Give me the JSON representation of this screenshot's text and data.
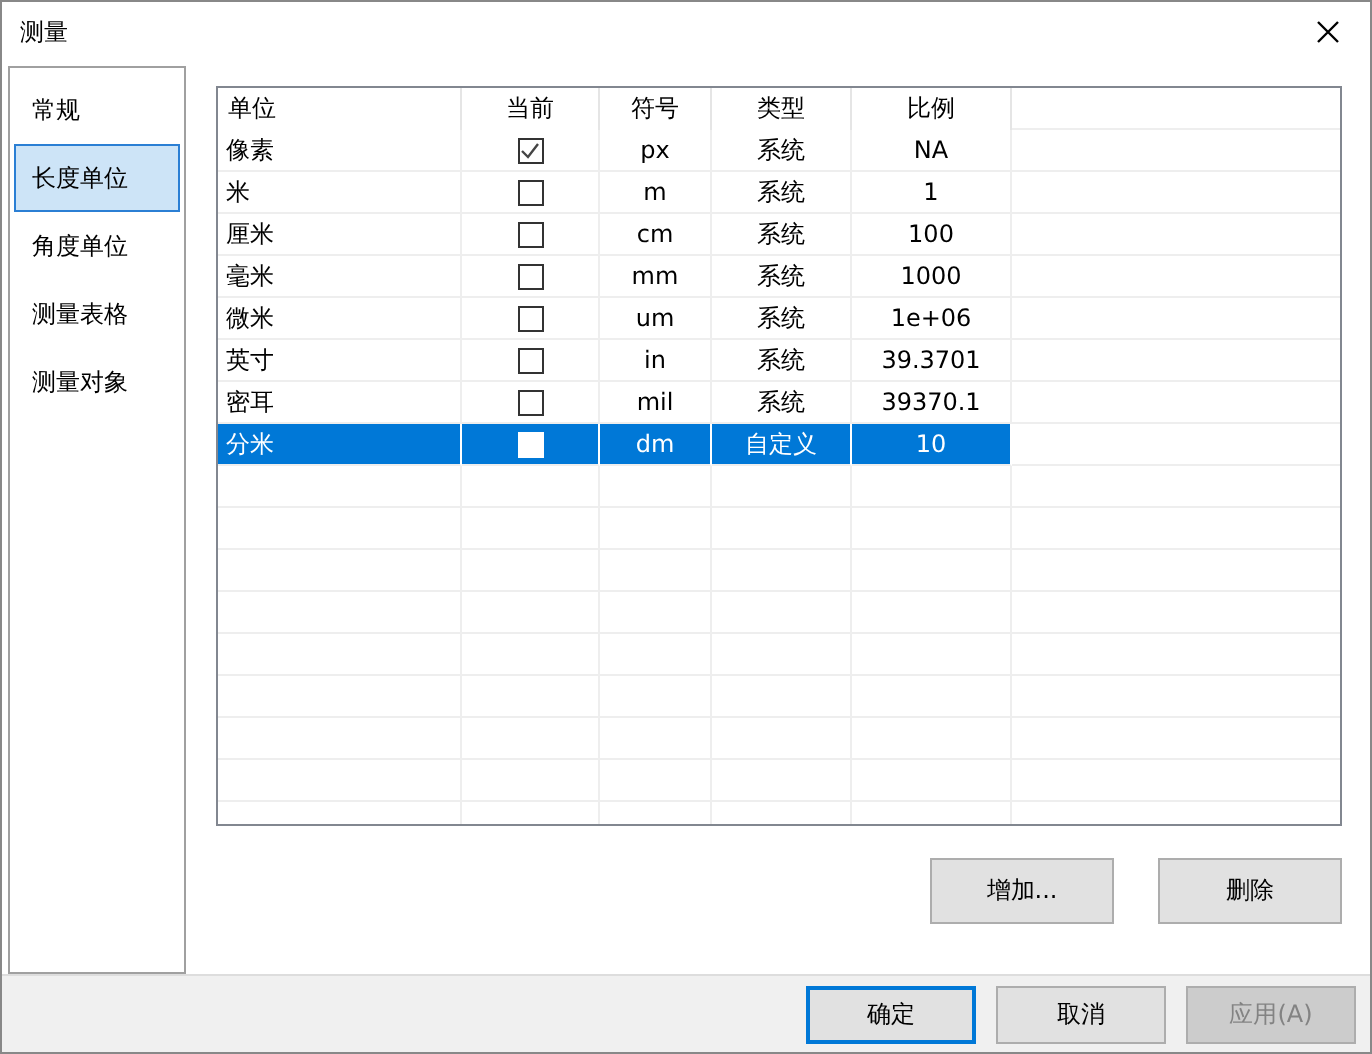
{
  "window": {
    "title": "测量"
  },
  "sidebar": {
    "items": [
      {
        "label": "常规",
        "selected": false
      },
      {
        "label": "长度单位",
        "selected": true
      },
      {
        "label": "角度单位",
        "selected": false
      },
      {
        "label": "测量表格",
        "selected": false
      },
      {
        "label": "测量对象",
        "selected": false
      }
    ]
  },
  "table": {
    "columns": [
      "单位",
      "当前",
      "符号",
      "类型",
      "比例"
    ],
    "rows": [
      {
        "name": "像素",
        "current": true,
        "symbol": "px",
        "type": "系统",
        "ratio": "NA",
        "selected": false
      },
      {
        "name": "米",
        "current": false,
        "symbol": "m",
        "type": "系统",
        "ratio": "1",
        "selected": false
      },
      {
        "name": "厘米",
        "current": false,
        "symbol": "cm",
        "type": "系统",
        "ratio": "100",
        "selected": false
      },
      {
        "name": "毫米",
        "current": false,
        "symbol": "mm",
        "type": "系统",
        "ratio": "1000",
        "selected": false
      },
      {
        "name": "微米",
        "current": false,
        "symbol": "um",
        "type": "系统",
        "ratio": "1e+06",
        "selected": false
      },
      {
        "name": "英寸",
        "current": false,
        "symbol": "in",
        "type": "系统",
        "ratio": "39.3701",
        "selected": false
      },
      {
        "name": "密耳",
        "current": false,
        "symbol": "mil",
        "type": "系统",
        "ratio": "39370.1",
        "selected": false
      },
      {
        "name": "分米",
        "current": false,
        "symbol": "dm",
        "type": "自定义",
        "ratio": "10",
        "selected": true
      }
    ]
  },
  "table_buttons": [
    "增加...",
    "删除"
  ],
  "dialog_buttons": [
    {
      "label": "确定",
      "default": true,
      "disabled": false
    },
    {
      "label": "取消",
      "default": false,
      "disabled": false
    },
    {
      "label": "应用(A)",
      "default": false,
      "disabled": true
    }
  ]
}
